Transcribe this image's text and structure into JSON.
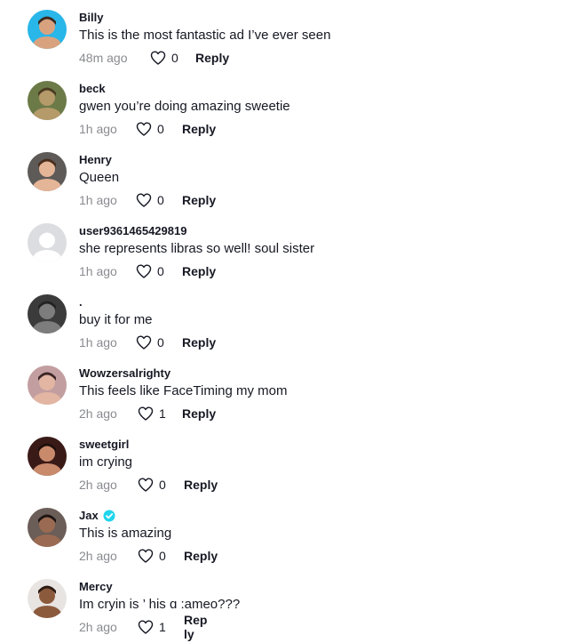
{
  "comments": [
    {
      "username": "Billy",
      "verified": false,
      "text": "This is the most fantastic ad I’ve ever seen",
      "time": "48m ago",
      "likes": "0",
      "reply": "Reply",
      "avatar": {
        "bg": "#29b6e8",
        "skin": "#d9a27f",
        "hair": "#3a2a1f"
      }
    },
    {
      "username": "beck",
      "verified": false,
      "text": "gwen you’re doing amazing sweetie",
      "time": "1h ago",
      "likes": "0",
      "reply": "Reply",
      "avatar": {
        "bg": "#6c7a48",
        "skin": "#b59a6a",
        "hair": "#4a3b22"
      }
    },
    {
      "username": "Henry",
      "verified": false,
      "text": "Queen",
      "time": "1h ago",
      "likes": "0",
      "reply": "Reply",
      "avatar": {
        "bg": "#5d5a58",
        "skin": "#e5b597",
        "hair": "#4a2e1c"
      }
    },
    {
      "username": "user9361465429819",
      "verified": false,
      "text": "she represents libras so well! soul sister",
      "time": "1h ago",
      "likes": "0",
      "reply": "Reply",
      "avatar": {
        "bg": "#dcdde0",
        "skin": "#ffffff",
        "hair": "#dcdde0"
      }
    },
    {
      "username": ".",
      "verified": false,
      "text": "buy it for me",
      "time": "1h ago",
      "likes": "0",
      "reply": "Reply",
      "avatar": {
        "bg": "#3b3b3b",
        "skin": "#7d7d7d",
        "hair": "#222222"
      }
    },
    {
      "username": "Wowzersalrighty",
      "verified": false,
      "text": "This feels like FaceTiming my mom",
      "time": "2h ago",
      "likes": "1",
      "reply": "Reply",
      "avatar": {
        "bg": "#c39ea0",
        "skin": "#e2b6a3",
        "hair": "#3d2626"
      }
    },
    {
      "username": "sweetgirl",
      "verified": false,
      "text": "im crying",
      "time": "2h ago",
      "likes": "0",
      "reply": "Reply",
      "avatar": {
        "bg": "#3a1a17",
        "skin": "#c98a6c",
        "hair": "#1e0f0c"
      }
    },
    {
      "username": "Jax",
      "verified": true,
      "text": "This is amazing",
      "time": "2h ago",
      "likes": "0",
      "reply": "Reply",
      "avatar": {
        "bg": "#6b5d57",
        "skin": "#9a6b52",
        "hair": "#1c1412"
      }
    },
    {
      "username": "Mercy",
      "verified": false,
      "text": "Im cryin is ’ his ɑ :ameo???",
      "time": "2h ago",
      "likes": "1",
      "reply": "Rep ly",
      "avatar": {
        "bg": "#e8e4e2",
        "skin": "#8b5a3c",
        "hair": "#2b1a12"
      }
    }
  ],
  "colors": {
    "text": "#161823",
    "muted": "#8a8b91",
    "verified": "#20d5ec",
    "background": "#ffffff"
  },
  "icons": {
    "like": "heart-outline-icon",
    "verified": "verified-check-icon"
  }
}
